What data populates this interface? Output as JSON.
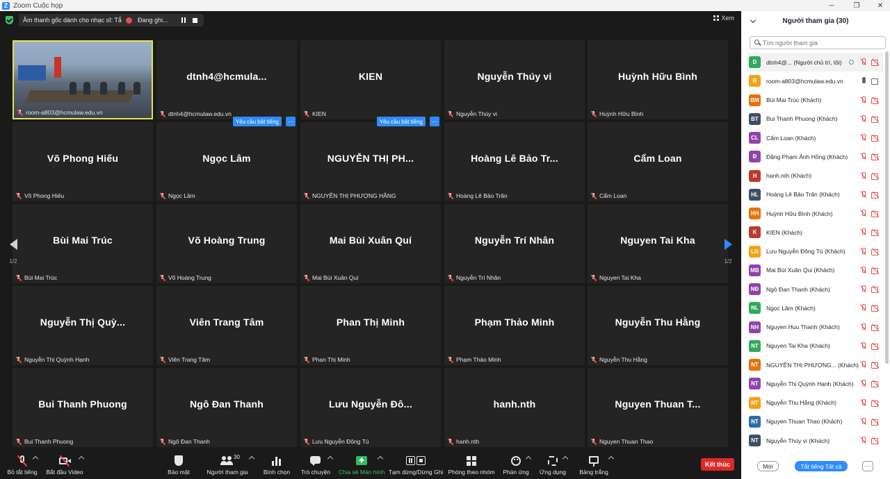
{
  "window": {
    "title": "Zoom Cuộc họp",
    "minimize": "─",
    "restore": "❐",
    "close": "✕"
  },
  "topbar": {
    "original_sound": "Âm thanh gốc dành cho nhạc sĩ: Tắt",
    "recording": "Đang ghi...",
    "view": "Xem"
  },
  "gallery": {
    "page": "1/2",
    "tiles": [
      {
        "big": "",
        "label": "room-a803@hcmulaw.edu.vn",
        "video": true
      },
      {
        "big": "dtnh4@hcmula...",
        "label": "dtnh4@hcmulaw.edu.vn"
      },
      {
        "big": "KIEN",
        "label": "KIEN"
      },
      {
        "big": "Nguyễn Thúy vi",
        "label": "Nguyễn Thúy vi"
      },
      {
        "big": "Huỳnh Hữu Bình",
        "label": "Huỳnh Hữu Bình"
      },
      {
        "big": "Võ Phong Hiếu",
        "label": "Võ Phong Hiếu"
      },
      {
        "big": "Ngọc Lâm",
        "label": "Ngọc Lâm",
        "request": "Yêu cầu bật tiếng"
      },
      {
        "big": "NGUYỄN THỊ PH...",
        "label": "NGUYỄN THỊ PHƯỢNG HẰNG",
        "request": "Yêu cầu bật tiếng"
      },
      {
        "big": "Hoàng Lê Bảo Tr...",
        "label": "Hoàng Lê Bảo Trân"
      },
      {
        "big": "Cẩm Loan",
        "label": "Cẩm Loan"
      },
      {
        "big": "Bùi Mai Trúc",
        "label": "Bùi Mai Trúc"
      },
      {
        "big": "Võ Hoàng Trung",
        "label": "Võ Hoàng Trung"
      },
      {
        "big": "Mai Bùi Xuân Quí",
        "label": "Mai Bùi Xuân Quí"
      },
      {
        "big": "Nguyễn Trí Nhân",
        "label": "Nguyễn Trí Nhân"
      },
      {
        "big": "Nguyen Tai Kha",
        "label": "Nguyen Tai Kha"
      },
      {
        "big": "Nguyễn Thị Quỳ...",
        "label": "Nguyễn Thị Quỳnh Hạnh"
      },
      {
        "big": "Viên Trang Tâm",
        "label": "Viên Trang Tâm"
      },
      {
        "big": "Phan Thị Minh",
        "label": "Phan Thị Minh"
      },
      {
        "big": "Phạm Thảo Minh",
        "label": "Phạm Thảo Minh"
      },
      {
        "big": "Nguyễn Thu Hằng",
        "label": "Nguyễn Thu Hằng"
      },
      {
        "big": "Bui Thanh Phuong",
        "label": "Bui Thanh Phuong"
      },
      {
        "big": "Ngô Đan Thanh",
        "label": "Ngô Đan Thanh"
      },
      {
        "big": "Lưu Nguyễn Đô...",
        "label": "Lưu Nguyễn Đông Tú"
      },
      {
        "big": "hanh.nth",
        "label": "hanh.nth"
      },
      {
        "big": "Nguyen Thuan T...",
        "label": "Nguyen Thuan Thao"
      }
    ]
  },
  "toolbar": {
    "unmute": "Bỏ tắt tiếng",
    "start_video": "Bắt đầu Video",
    "security": "Bảo mật",
    "participants": "Người tham gia",
    "participants_count": "30",
    "polls": "Bình chọn",
    "chat": "Trò chuyện",
    "share_screen": "Chia sẻ Màn hình",
    "pause_stop_rec": "Tạm dừng/Dừng Ghi",
    "breakout": "Phòng theo nhóm",
    "reactions": "Phản ứng",
    "apps": "Ứng dụng",
    "whiteboard": "Bảng trắng",
    "end": "Kết thúc"
  },
  "panel": {
    "title": "Người tham gia (30)",
    "search_placeholder": "Tìm người tham gia",
    "participants": [
      {
        "initials": "D",
        "color": "#2eaa5c",
        "name": "dtnh4@... (Người chủ trì, tôi)",
        "host": true
      },
      {
        "initials": "R",
        "color": "#f4a214",
        "name": "room-a803@hcmulaw.edu.vn",
        "mic_on": true,
        "cam_on": true
      },
      {
        "initials": "BM",
        "color": "#e8710a",
        "name": "Bùi Mai Trúc (Khách)"
      },
      {
        "initials": "BT",
        "color": "#3d4f63",
        "name": "Bui Thanh Phuong (Khách)"
      },
      {
        "initials": "CL",
        "color": "#8e44ad",
        "name": "Cẩm Loan (Khách)"
      },
      {
        "initials": "Đ",
        "color": "#8e44ad",
        "name": "Đặng Phạm Ánh Hồng (Khách)"
      },
      {
        "initials": "H",
        "color": "#c0392b",
        "name": "hanh.nth (Khách)"
      },
      {
        "initials": "HL",
        "color": "#3d4f63",
        "name": "Hoàng Lê Bảo Trân (Khách)"
      },
      {
        "initials": "HH",
        "color": "#e8710a",
        "name": "Huỳnh Hữu Bình (Khách)"
      },
      {
        "initials": "K",
        "color": "#c0392b",
        "name": "KIEN (Khách)"
      },
      {
        "initials": "LN",
        "color": "#f4a214",
        "name": "Lưu Nguyễn Đông Tú (Khách)"
      },
      {
        "initials": "MB",
        "color": "#8e44ad",
        "name": "Mai Bùi Xuân Qui (Khách)"
      },
      {
        "initials": "NĐ",
        "color": "#8e44ad",
        "name": "Ngô Đan Thanh (Khách)"
      },
      {
        "initials": "NL",
        "color": "#2eaa5c",
        "name": "Ngọc Lâm (Khách)"
      },
      {
        "initials": "NH",
        "color": "#8e44ad",
        "name": "Nguyen Huu Thanh (Khách)"
      },
      {
        "initials": "NT",
        "color": "#2eaa5c",
        "name": "Nguyen Tai Kha (Khách)"
      },
      {
        "initials": "NT",
        "color": "#e8710a",
        "name": "NGUYỄN THỊ PHƯỢNG... (Khách)"
      },
      {
        "initials": "NT",
        "color": "#8e44ad",
        "name": "Nguyễn Thị Quỳnh Hanh (Khách)"
      },
      {
        "initials": "NT",
        "color": "#f4a214",
        "name": "Nguyễn Thu Hằng (Khách)"
      },
      {
        "initials": "NT",
        "color": "#2c6ea8",
        "name": "Nguyen Thuan Thao (Khách)"
      },
      {
        "initials": "NT",
        "color": "#3d4f63",
        "name": "Nguyễn Thúy vi (Khách)"
      }
    ],
    "invite": "Mời",
    "mute_all": "Tắt tiếng Tất cả",
    "more": "···"
  }
}
